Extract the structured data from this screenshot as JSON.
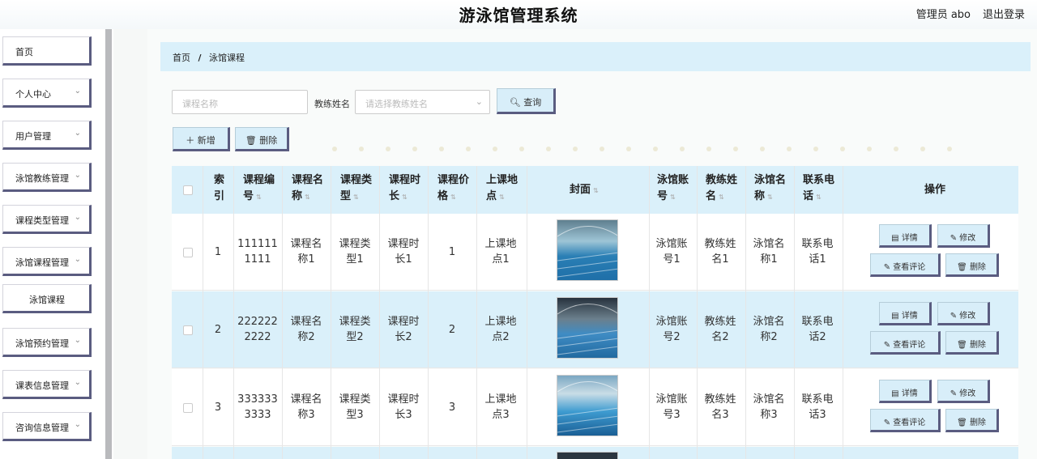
{
  "header": {
    "title": "游泳馆管理系统",
    "admin": "管理员 abo",
    "logout": "退出登录"
  },
  "sidebar": {
    "items": [
      {
        "label": "首页",
        "chev": false
      },
      {
        "label": "个人中心",
        "chev": true
      },
      {
        "label": "用户管理",
        "chev": true
      },
      {
        "label": "泳馆教练管理",
        "chev": true
      },
      {
        "label": "课程类型管理",
        "chev": true
      },
      {
        "label": "泳馆课程管理",
        "chev": true
      },
      {
        "label": "泳馆课程",
        "chev": false
      },
      {
        "label": "泳馆预约管理",
        "chev": true
      },
      {
        "label": "课表信息管理",
        "chev": true
      },
      {
        "label": "咨询信息管理",
        "chev": true
      }
    ],
    "chevron": "⌄"
  },
  "breadcrumb": {
    "home": "首页",
    "sep": "/",
    "current": "泳馆课程"
  },
  "search": {
    "course_placeholder": "课程名称",
    "coach_label": "教练姓名",
    "coach_placeholder": "请选择教练姓名",
    "query_label": "查询",
    "add_label": "新增",
    "delete_label": "删除"
  },
  "table": {
    "headers": {
      "index": [
        "索",
        "引"
      ],
      "code": [
        "课程编",
        "号"
      ],
      "name": [
        "课程名",
        "称"
      ],
      "type": [
        "课程类",
        "型"
      ],
      "duration": [
        "课程时",
        "长"
      ],
      "price": [
        "课程价",
        "格"
      ],
      "place": [
        "上课地",
        "点"
      ],
      "cover": "封面",
      "account": [
        "泳馆账",
        "号"
      ],
      "coach": [
        "教练姓",
        "名"
      ],
      "venue": [
        "泳馆名",
        "称"
      ],
      "phone": [
        "联系电",
        "话"
      ],
      "ops": "操作"
    },
    "rows": [
      {
        "index": "1",
        "code": [
          "111111",
          "1111"
        ],
        "name": [
          "课程名",
          "称1"
        ],
        "type": [
          "课程类",
          "型1"
        ],
        "duration": [
          "课程时",
          "长1"
        ],
        "price": "1",
        "place": [
          "上课地",
          "点1"
        ],
        "account": [
          "泳馆账",
          "号1"
        ],
        "coach": [
          "教练姓",
          "名1"
        ],
        "venue": [
          "泳馆名",
          "称1"
        ],
        "phone": [
          "联系电",
          "话1"
        ]
      },
      {
        "index": "2",
        "code": [
          "222222",
          "2222"
        ],
        "name": [
          "课程名",
          "称2"
        ],
        "type": [
          "课程类",
          "型2"
        ],
        "duration": [
          "课程时",
          "长2"
        ],
        "price": "2",
        "place": [
          "上课地",
          "点2"
        ],
        "account": [
          "泳馆账",
          "号2"
        ],
        "coach": [
          "教练姓",
          "名2"
        ],
        "venue": [
          "泳馆名",
          "称2"
        ],
        "phone": [
          "联系电",
          "话2"
        ]
      },
      {
        "index": "3",
        "code": [
          "333333",
          "3333"
        ],
        "name": [
          "课程名",
          "称3"
        ],
        "type": [
          "课程类",
          "型3"
        ],
        "duration": [
          "课程时",
          "长3"
        ],
        "price": "3",
        "place": [
          "上课地",
          "点3"
        ],
        "account": [
          "泳馆账",
          "号3"
        ],
        "coach": [
          "教练姓",
          "名3"
        ],
        "venue": [
          "泳馆名",
          "称3"
        ],
        "phone": [
          "联系电",
          "话3"
        ]
      }
    ],
    "actions": {
      "detail": "详情",
      "edit": "修改",
      "comments": "查看评论",
      "delete": "删除"
    }
  },
  "colors": {
    "accent": "#daf0fa",
    "button_border": "#5a5c80",
    "rail": "#b9babd"
  }
}
